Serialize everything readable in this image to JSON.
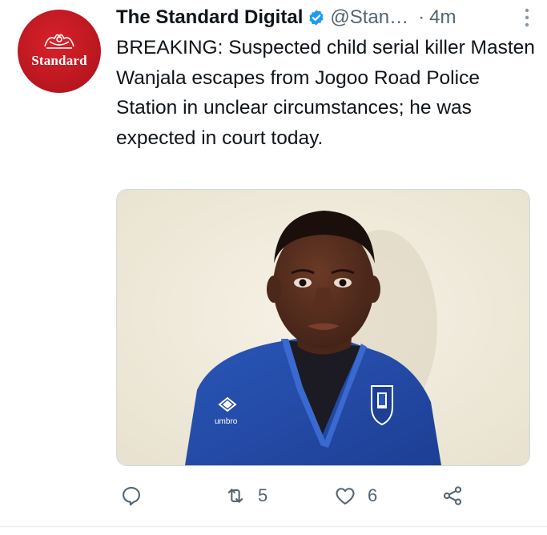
{
  "account": {
    "display_name": "The Standard Digital",
    "handle": "@Stan…",
    "separator": "·",
    "time": "4m",
    "avatar_text": "Standard",
    "brand_color": "#c8191f",
    "verified_color": "#1d9bf0"
  },
  "tweet": {
    "text": "BREAKING: Suspected child serial killer Masten Wanjala escapes from Jogoo Road Police Station in unclear circumstances; he was expected in court today."
  },
  "media": {
    "type": "photo",
    "shirt_brand_text": "umbro"
  },
  "actions": {
    "reply": {
      "icon": "reply-icon",
      "count": ""
    },
    "retweet": {
      "icon": "retweet-icon",
      "count": "5"
    },
    "like": {
      "icon": "heart-icon",
      "count": "6"
    },
    "share": {
      "icon": "share-icon",
      "count": ""
    }
  },
  "colors": {
    "secondary_text": "#536471",
    "primary_text": "#0f1419"
  }
}
